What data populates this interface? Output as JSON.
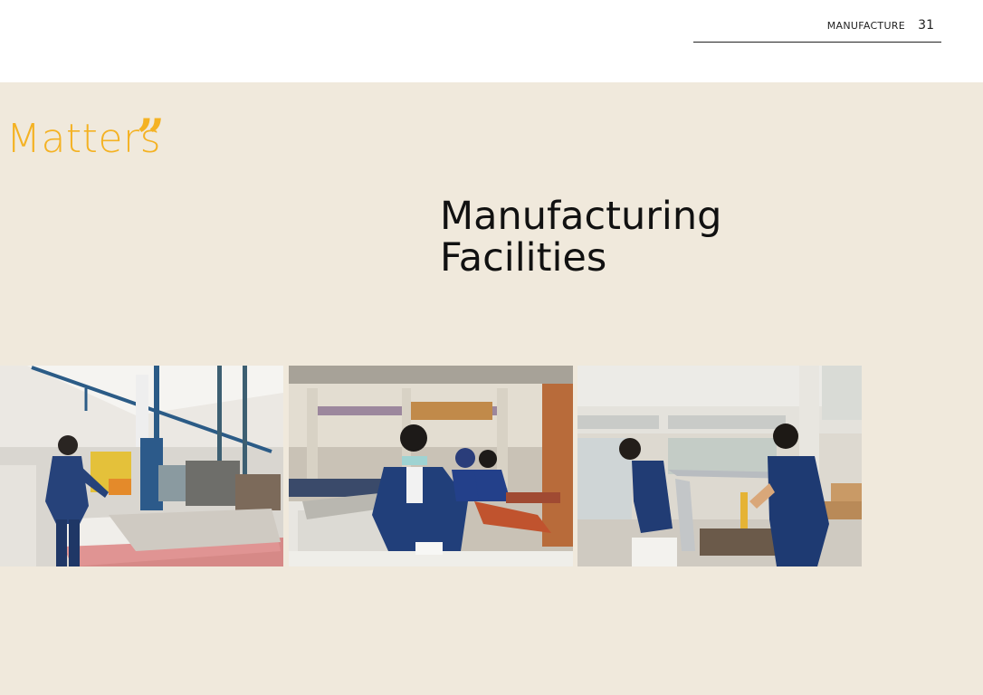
{
  "header": {
    "section_label": "MANUFACTURE",
    "page_number": "31"
  },
  "pull_quote": {
    "word": "Matters",
    "mark": "”"
  },
  "title": {
    "line1": "Manufacturing",
    "line2": "Facilities"
  },
  "colors": {
    "accent": "#f4b223",
    "background": "#f0e9dc",
    "text": "#111111"
  },
  "photos": [
    {
      "subject": "worker-operating-cnc-machine"
    },
    {
      "subject": "workers-sewing-upholstery"
    },
    {
      "subject": "workers-assembling-chair-frames"
    }
  ]
}
